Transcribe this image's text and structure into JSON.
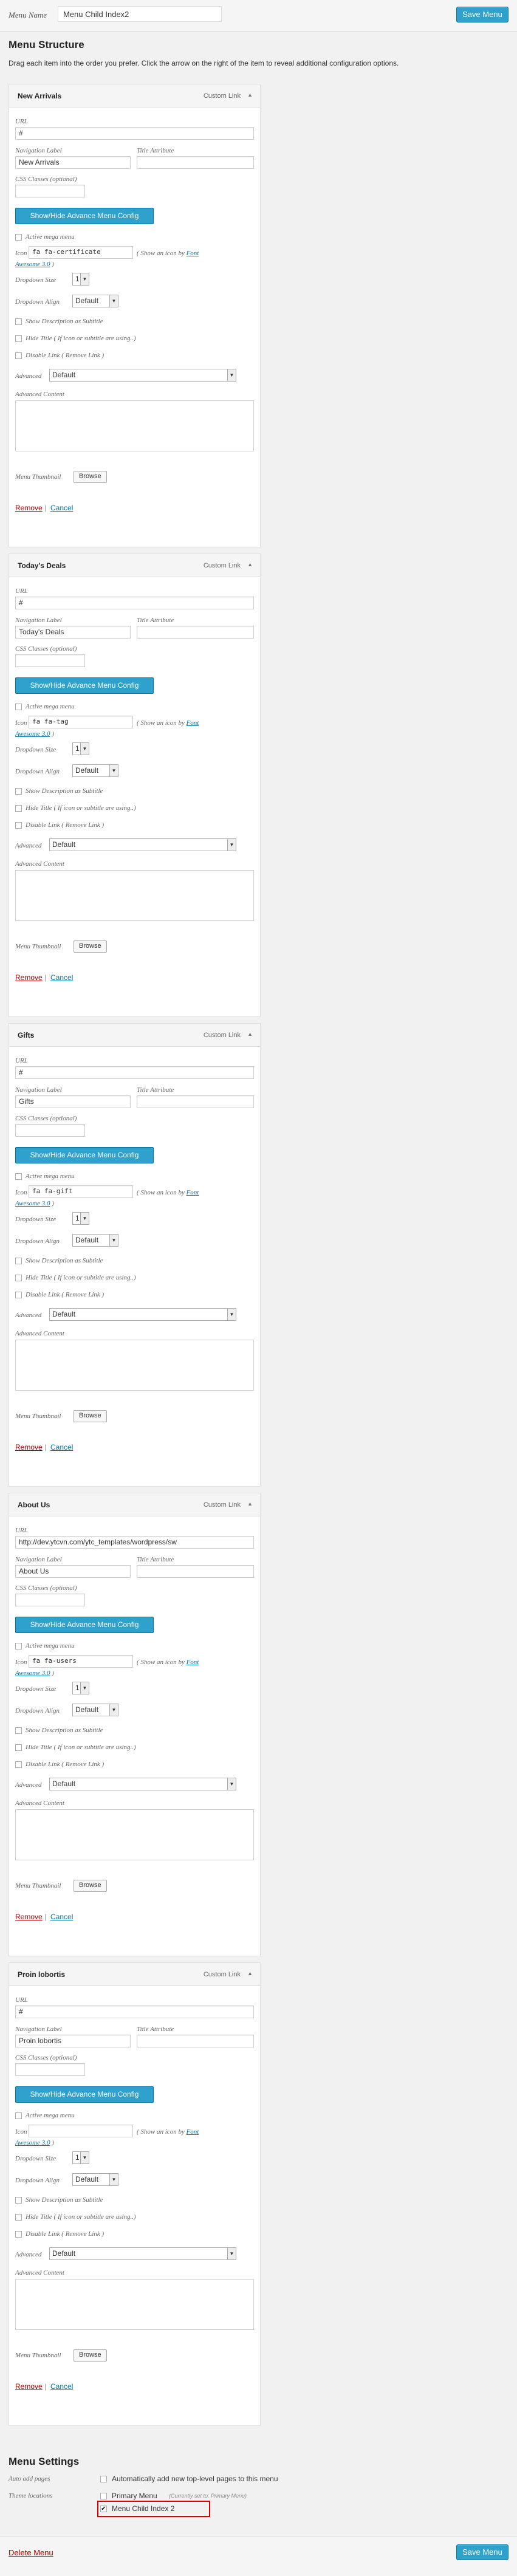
{
  "header": {
    "menu_name_label": "Menu Name",
    "menu_name_value": "Menu Child Index2",
    "save_label": "Save Menu"
  },
  "structure": {
    "title": "Menu Structure",
    "description": "Drag each item into the order you prefer. Click the arrow on the right of the item to reveal additional configuration options."
  },
  "labels": {
    "url": "URL",
    "nav_label": "Navigation Label",
    "title_attr": "Title Attribute",
    "css": "CSS Classes (optional)",
    "adv_btn": "Show/Hide Advance Menu Config",
    "mega": "Active mega menu",
    "icon": "Icon",
    "icon_hint_pre": "( Show an icon by ",
    "icon_hint_link1": "Font",
    "icon_hint_link2": "Awesome 3.0",
    "icon_hint_post": " )",
    "dropdown_size": "Dropdown Size",
    "dropdown_align": "Dropdown Align",
    "show_desc": "Show Description as Subtitle",
    "hide_title": "Hide Title ( If icon or subtitle are using..)",
    "disable_link": "Disable Link ( Remove Link )",
    "advanced": "Advanced",
    "advanced_content": "Advanced Content",
    "thumbnail": "Menu Thumbnail",
    "browse": "Browse",
    "remove": "Remove",
    "separator": "|",
    "cancel": "Cancel",
    "type": "Custom Link",
    "size_value": "1",
    "align_value": "Default",
    "advanced_value": "Default"
  },
  "items": [
    {
      "title": "New Arrivals",
      "url": "#",
      "nav_label": "New Arrivals",
      "icon": "fa fa-certificate"
    },
    {
      "title": "Today's Deals",
      "url": "#",
      "nav_label": "Today's Deals",
      "icon": "fa fa-tag"
    },
    {
      "title": "Gifts",
      "url": "#",
      "nav_label": "Gifts",
      "icon": "fa fa-gift"
    },
    {
      "title": "About Us",
      "url": "http://dev.ytcvn.com/ytc_templates/wordpress/sw",
      "nav_label": "About Us",
      "icon": "fa fa-users"
    },
    {
      "title": "Proin lobortis",
      "url": "#",
      "nav_label": "Proin lobortis",
      "icon": ""
    }
  ],
  "settings": {
    "title": "Menu Settings",
    "auto_add_label": "Auto add pages",
    "auto_add_text": "Automatically add new top-level pages to this menu",
    "locations_label": "Theme locations",
    "primary_label": "Primary Menu",
    "primary_note": "(Currently set to: Primary Menu)",
    "child_label": "Menu Child Index 2"
  },
  "footer": {
    "delete_label": "Delete Menu",
    "save_label": "Save Menu"
  },
  "colors": {
    "accent": "#2ea2cc",
    "danger": "#a00000",
    "highlight": "#dd0000"
  }
}
